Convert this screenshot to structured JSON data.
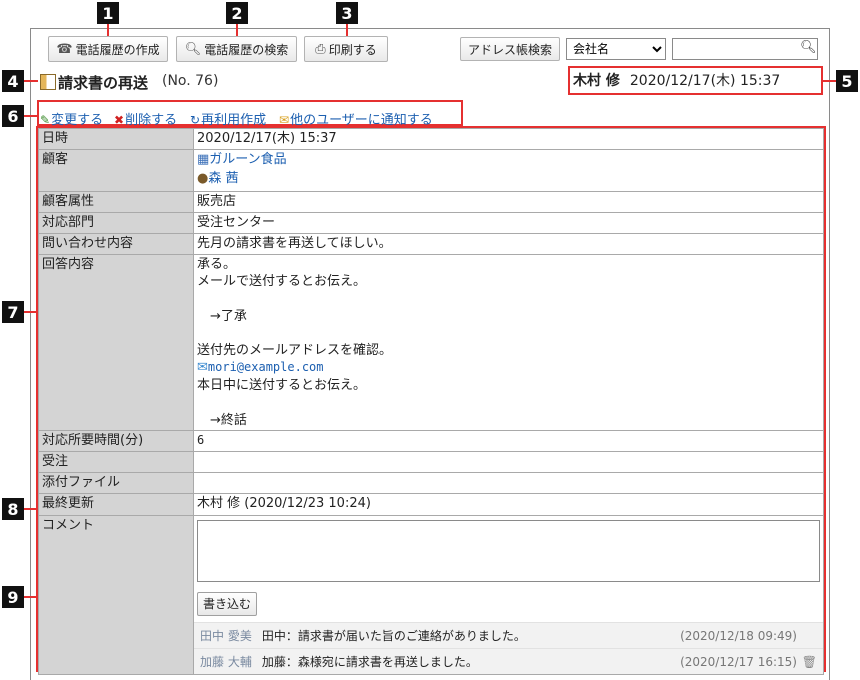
{
  "toolbar": {
    "create_history": "電話履歴の作成",
    "search_history": "電話履歴の検索",
    "print": "印刷する",
    "addressbook_search": "アドレス帳検索",
    "company_select": "会社名",
    "search_value": ""
  },
  "markers": [
    "1",
    "2",
    "3",
    "4",
    "5",
    "6",
    "7",
    "8",
    "9"
  ],
  "header": {
    "title": "請求書の再送",
    "number": "(No. 76)",
    "user": "木村 修",
    "datetime": "2020/12/17(木) 15:37"
  },
  "actions": {
    "edit": "変更する",
    "delete": "削除する",
    "reuse": "再利用作成",
    "notify": "他のユーザーに通知する"
  },
  "fields": {
    "datetime_label": "日時",
    "datetime_value": "2020/12/17(木) 15:37",
    "customer_label": "顧客",
    "customer_company": "ガルーン食品",
    "customer_person": "森 茜",
    "attribute_label": "顧客属性",
    "attribute_value": "販売店",
    "dept_label": "対応部門",
    "dept_value": "受注センター",
    "inquiry_label": "問い合わせ内容",
    "inquiry_value": "先月の請求書を再送してほしい。",
    "answer_label": "回答内容",
    "answer_part1": "承る。\nメールで送付するとお伝え。\n\n　→了承\n\n送付先のメールアドレスを確認。",
    "answer_email": "mori@example.com",
    "answer_part2": "本日中に送付するとお伝え。\n\n　→終話",
    "time_label": "対応所要時間(分)",
    "time_value": "6",
    "order_label": "受注",
    "order_value": "",
    "attach_label": "添付ファイル",
    "attach_value": "",
    "updated_label": "最終更新",
    "updated_value": "木村 修 (2020/12/23 10:24)",
    "comment_label": "コメント"
  },
  "comments": {
    "write_button": "書き込む",
    "items": [
      {
        "author": "田中 愛美",
        "text": "田中：請求書が届いた旨のご連絡がありました。",
        "date": "(2020/12/18 09:49)"
      },
      {
        "author": "加藤 大輔",
        "text": "加藤：森様宛に請求書を再送しました。",
        "date": "(2020/12/17 16:15)"
      }
    ]
  },
  "colors": {
    "accent_red": "#e53030",
    "link": "#1c5fb0",
    "label_bg": "#d4d4d4"
  }
}
